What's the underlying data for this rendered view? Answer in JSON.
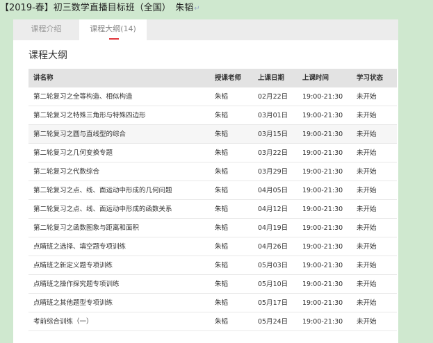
{
  "doc": {
    "title": "【2019-春】初三数学直播目标班（全国）　朱韬",
    "paragraph_mark": "↵"
  },
  "tabs": {
    "intro": "课程介绍",
    "outline": "课程大纲(14)"
  },
  "section_title": "课程大纲",
  "table": {
    "headers": {
      "name": "讲名称",
      "teacher": "授课老师",
      "date": "上课日期",
      "time": "上课时间",
      "status": "学习状态"
    },
    "rows": [
      {
        "name": "第二轮复习之全等构造、相似构造",
        "teacher": "朱韬",
        "date": "02月22日",
        "time": "19:00-21:30",
        "status": "未开始"
      },
      {
        "name": "第二轮复习之特殊三角形与特殊四边形",
        "teacher": "朱韬",
        "date": "03月01日",
        "time": "19:00-21:30",
        "status": "未开始"
      },
      {
        "name": "第二轮复习之圆与直线型的综合",
        "teacher": "朱韬",
        "date": "03月15日",
        "time": "19:00-21:30",
        "status": "未开始"
      },
      {
        "name": "第二轮复习之几何变换专题",
        "teacher": "朱韬",
        "date": "03月22日",
        "time": "19:00-21:30",
        "status": "未开始"
      },
      {
        "name": "第二轮复习之代数综合",
        "teacher": "朱韬",
        "date": "03月29日",
        "time": "19:00-21:30",
        "status": "未开始"
      },
      {
        "name": "第二轮复习之点、线、面运动中形成的几何问题",
        "teacher": "朱韬",
        "date": "04月05日",
        "time": "19:00-21:30",
        "status": "未开始"
      },
      {
        "name": "第二轮复习之点、线、面运动中形成的函数关系",
        "teacher": "朱韬",
        "date": "04月12日",
        "time": "19:00-21:30",
        "status": "未开始"
      },
      {
        "name": "第二轮复习之函数图象与距离和面积",
        "teacher": "朱韬",
        "date": "04月19日",
        "time": "19:00-21:30",
        "status": "未开始"
      },
      {
        "name": "点睛班之选择、填空题专项训练",
        "teacher": "朱韬",
        "date": "04月26日",
        "time": "19:00-21:30",
        "status": "未开始"
      },
      {
        "name": "点睛班之新定义题专项训练",
        "teacher": "朱韬",
        "date": "05月03日",
        "time": "19:00-21:30",
        "status": "未开始"
      },
      {
        "name": "点睛班之操作探究题专项训练",
        "teacher": "朱韬",
        "date": "05月10日",
        "time": "19:00-21:30",
        "status": "未开始"
      },
      {
        "name": "点睛班之其他题型专项训练",
        "teacher": "朱韬",
        "date": "05月17日",
        "time": "19:00-21:30",
        "status": "未开始"
      },
      {
        "name": "考前综合训练（一）",
        "teacher": "朱韬",
        "date": "05月24日",
        "time": "19:00-21:30",
        "status": "未开始"
      }
    ]
  }
}
